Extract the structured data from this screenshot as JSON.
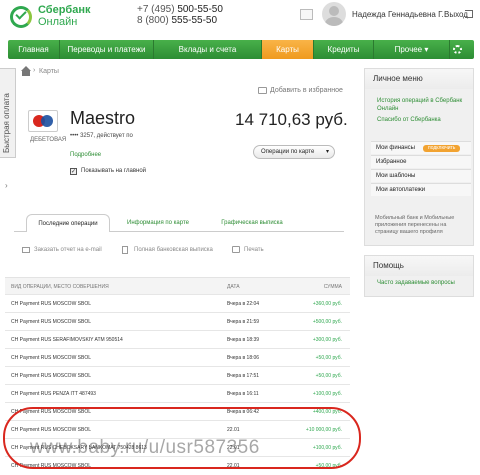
{
  "header": {
    "brand_line1": "Сбербанк",
    "brand_line2": "Онлайн",
    "phone1_prefix": "+7 (495)",
    "phone1_num": "500-55-50",
    "phone2_prefix": "8 (800)",
    "phone2_num": "555-55-50",
    "user_name": "Надежда Геннадьевна Г.",
    "logout_label": "Выход"
  },
  "nav": {
    "items": [
      {
        "label": "Главная"
      },
      {
        "label": "Переводы и платежи"
      },
      {
        "label": "Вклады и счета"
      },
      {
        "label": "Карты"
      },
      {
        "label": "Кредиты"
      },
      {
        "label": "Прочее"
      }
    ],
    "active": "Карты"
  },
  "side_tab": {
    "label": "Быстрая оплата"
  },
  "breadcrumb": {
    "label": "Карты"
  },
  "card": {
    "add_fav_label": "Добавить в избранное",
    "name": "Maestro",
    "number_text": "•••• 3257, действует по",
    "type_label": "ДЕБЕТОВАЯ",
    "balance": "14 710,63 руб.",
    "details_link": "Подробнее",
    "ops_button": "Операции по карте",
    "show_on_main_label": "Показывать на главной",
    "show_on_main_checked": true
  },
  "tabs": [
    {
      "label": "Последние операции"
    },
    {
      "label": "Информация по карте"
    },
    {
      "label": "Графическая выписка"
    }
  ],
  "actions": [
    {
      "label": "Заказать отчет на e-mail"
    },
    {
      "label": "Полная банковская выписка"
    },
    {
      "label": "Печать"
    }
  ],
  "table": {
    "headers": [
      "ВИД ОПЕРАЦИИ, МЕСТО СОВЕРШЕНИЯ",
      "ДАТА",
      "СУММА"
    ],
    "rows": [
      {
        "desc": "CH Payment RUS MOSCOW SBOL",
        "date": "Вчера в 22:04",
        "amount": "+360,00 руб."
      },
      {
        "desc": "CH Payment RUS MOSCOW SBOL",
        "date": "Вчера в 21:59",
        "amount": "+500,00 руб."
      },
      {
        "desc": "CH Payment RUS SERAFIMOVSKIY ATM 950514",
        "date": "Вчера в 18:39",
        "amount": "+300,00 руб."
      },
      {
        "desc": "CH Payment RUS MOSCOW SBOL",
        "date": "Вчера в 18:06",
        "amount": "+50,00 руб."
      },
      {
        "desc": "CH Payment RUS MOSCOW SBOL",
        "date": "Вчера в 17:51",
        "amount": "+50,00 руб."
      },
      {
        "desc": "CH Payment RUS PENZA ITT 487493",
        "date": "Вчера в 16:11",
        "amount": "+100,00 руб."
      },
      {
        "desc": "CH Payment RUS MOSCOW SBOL",
        "date": "Вчера в 06:42",
        "amount": "+400,00 руб."
      },
      {
        "desc": "CH Payment RUS MOSCOW SBOL",
        "date": "22.01",
        "amount": "+10 000,00 руб."
      },
      {
        "desc": "CH Payment RUS CHEBOKSARY BANKOMAT 750428 8613",
        "date": "22.01",
        "amount": "+100,00 руб."
      },
      {
        "desc": "CH Payment RUS MOSCOW SBOL",
        "date": "22.01",
        "amount": "+50,00 руб."
      }
    ]
  },
  "personal_menu": {
    "title": "Личное меню",
    "links": [
      "История операций в Сбербанк Онлайн",
      "Спасибо от Сбербанка"
    ],
    "items": [
      {
        "label": "Мои финансы",
        "badge": "подключить"
      },
      {
        "label": "Избранное"
      },
      {
        "label": "Мои шаблоны"
      },
      {
        "label": "Мои автоплатежи"
      }
    ],
    "mobile_note": "Мобильный банк и Мобильные приложения перенесены на страницу вашего профиля"
  },
  "help": {
    "title": "Помощь",
    "link": "Часто задаваемые вопросы"
  },
  "watermark": {
    "text": "www.baby.ru/u/usr587356"
  },
  "colors": {
    "green": "#2fa84f",
    "nav_green": "#2d8d34",
    "orange": "#f2a331",
    "highlight": "#d9271e"
  }
}
